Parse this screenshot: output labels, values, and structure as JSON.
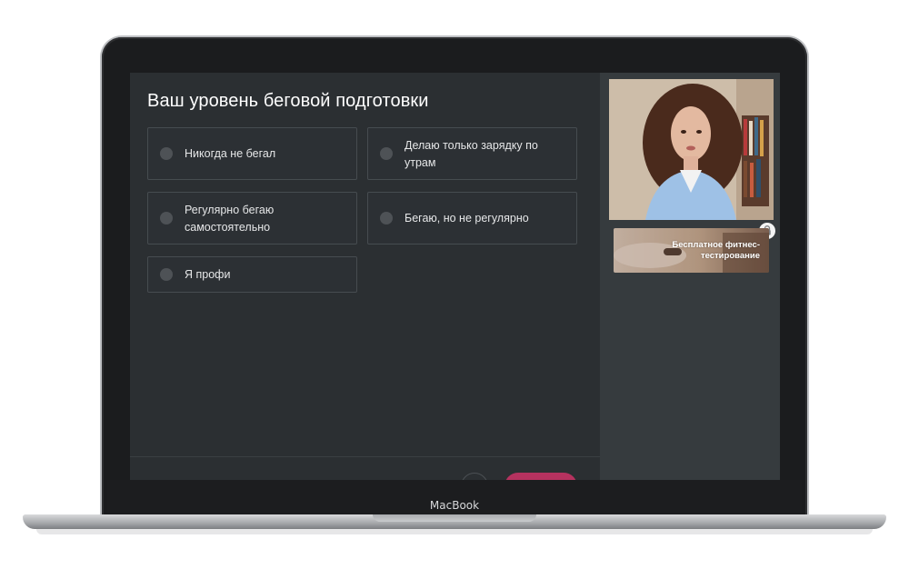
{
  "device": {
    "brand": "MacBook"
  },
  "quiz": {
    "question": "Ваш уровень беговой подготовки",
    "options": [
      {
        "label": "Никогда не бегал"
      },
      {
        "label": "Делаю только зарядку по утрам"
      },
      {
        "label": "Регулярно бегаю самостоятельно"
      },
      {
        "label": "Бегаю, но не регулярно"
      },
      {
        "label": "Я профи"
      }
    ]
  },
  "sidebar": {
    "promo_label": "Бесплатное фитнес-тестирование",
    "lock_icon": "lock-icon"
  },
  "colors": {
    "accent": "#b5325f",
    "accent_text": "#e2417e",
    "panel": "#2b2f32",
    "sidebar": "#363b3e"
  }
}
